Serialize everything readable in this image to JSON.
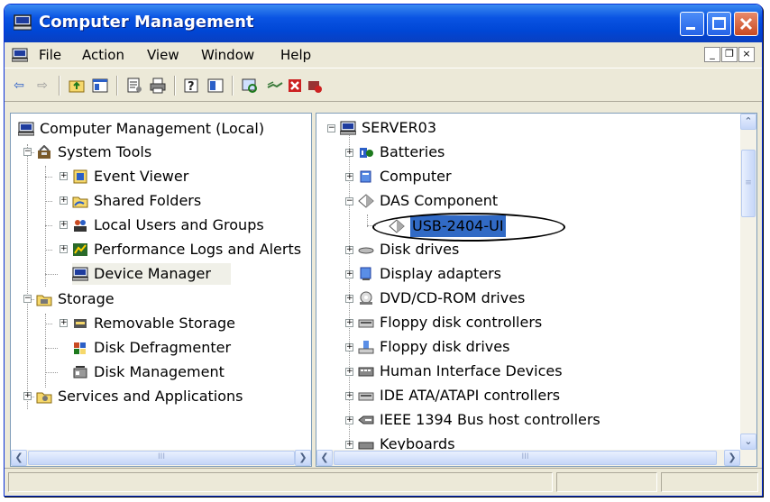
{
  "window": {
    "title": "Computer Management"
  },
  "menubar": {
    "items": [
      "File",
      "Action",
      "View",
      "Window",
      "Help"
    ]
  },
  "toolbar": {
    "buttons": [
      "back-arrow-icon",
      "forward-arrow-icon",
      "up-folder-icon",
      "show-hide-tree-icon",
      "properties-icon",
      "print-icon",
      "help-icon",
      "console-tree-icon",
      "scan-hardware-icon",
      "update-driver-icon",
      "uninstall-icon",
      "disable-icon"
    ]
  },
  "left_tree": {
    "root": "Computer Management (Local)",
    "system_tools": "System Tools",
    "event_viewer": "Event Viewer",
    "shared_folders": "Shared Folders",
    "local_users": "Local Users and Groups",
    "perf_logs": "Performance Logs and Alerts",
    "device_manager": "Device Manager",
    "storage": "Storage",
    "removable_storage": "Removable Storage",
    "disk_defrag": "Disk Defragmenter",
    "disk_mgmt": "Disk Management",
    "services": "Services and Applications"
  },
  "right_tree": {
    "root": "SERVER03",
    "items": [
      "Batteries",
      "Computer",
      "DAS Component",
      "USB-2404-UI",
      "Disk drives",
      "Display adapters",
      "DVD/CD-ROM drives",
      "Floppy disk controllers",
      "Floppy disk drives",
      "Human Interface Devices",
      "IDE ATA/ATAPI controllers",
      "IEEE 1394 Bus host controllers",
      "Keyboards"
    ]
  },
  "scroll": {
    "thumb_glyph": "III",
    "thumb_glyph_v": "≡"
  },
  "colors": {
    "titlebar": "#0A54E3",
    "selection": "#316AC5",
    "face": "#ECE9D8"
  }
}
